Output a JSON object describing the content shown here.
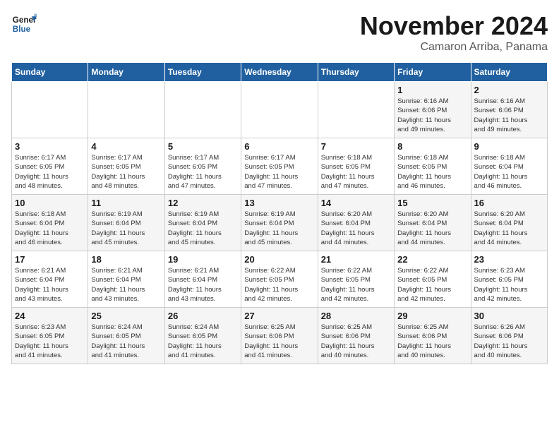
{
  "logo": {
    "text_general": "General",
    "text_blue": "Blue"
  },
  "header": {
    "month": "November 2024",
    "location": "Camaron Arriba, Panama"
  },
  "weekdays": [
    "Sunday",
    "Monday",
    "Tuesday",
    "Wednesday",
    "Thursday",
    "Friday",
    "Saturday"
  ],
  "weeks": [
    [
      {
        "day": "",
        "info": ""
      },
      {
        "day": "",
        "info": ""
      },
      {
        "day": "",
        "info": ""
      },
      {
        "day": "",
        "info": ""
      },
      {
        "day": "",
        "info": ""
      },
      {
        "day": "1",
        "info": "Sunrise: 6:16 AM\nSunset: 6:06 PM\nDaylight: 11 hours\nand 49 minutes."
      },
      {
        "day": "2",
        "info": "Sunrise: 6:16 AM\nSunset: 6:06 PM\nDaylight: 11 hours\nand 49 minutes."
      }
    ],
    [
      {
        "day": "3",
        "info": "Sunrise: 6:17 AM\nSunset: 6:05 PM\nDaylight: 11 hours\nand 48 minutes."
      },
      {
        "day": "4",
        "info": "Sunrise: 6:17 AM\nSunset: 6:05 PM\nDaylight: 11 hours\nand 48 minutes."
      },
      {
        "day": "5",
        "info": "Sunrise: 6:17 AM\nSunset: 6:05 PM\nDaylight: 11 hours\nand 47 minutes."
      },
      {
        "day": "6",
        "info": "Sunrise: 6:17 AM\nSunset: 6:05 PM\nDaylight: 11 hours\nand 47 minutes."
      },
      {
        "day": "7",
        "info": "Sunrise: 6:18 AM\nSunset: 6:05 PM\nDaylight: 11 hours\nand 47 minutes."
      },
      {
        "day": "8",
        "info": "Sunrise: 6:18 AM\nSunset: 6:05 PM\nDaylight: 11 hours\nand 46 minutes."
      },
      {
        "day": "9",
        "info": "Sunrise: 6:18 AM\nSunset: 6:04 PM\nDaylight: 11 hours\nand 46 minutes."
      }
    ],
    [
      {
        "day": "10",
        "info": "Sunrise: 6:18 AM\nSunset: 6:04 PM\nDaylight: 11 hours\nand 46 minutes."
      },
      {
        "day": "11",
        "info": "Sunrise: 6:19 AM\nSunset: 6:04 PM\nDaylight: 11 hours\nand 45 minutes."
      },
      {
        "day": "12",
        "info": "Sunrise: 6:19 AM\nSunset: 6:04 PM\nDaylight: 11 hours\nand 45 minutes."
      },
      {
        "day": "13",
        "info": "Sunrise: 6:19 AM\nSunset: 6:04 PM\nDaylight: 11 hours\nand 45 minutes."
      },
      {
        "day": "14",
        "info": "Sunrise: 6:20 AM\nSunset: 6:04 PM\nDaylight: 11 hours\nand 44 minutes."
      },
      {
        "day": "15",
        "info": "Sunrise: 6:20 AM\nSunset: 6:04 PM\nDaylight: 11 hours\nand 44 minutes."
      },
      {
        "day": "16",
        "info": "Sunrise: 6:20 AM\nSunset: 6:04 PM\nDaylight: 11 hours\nand 44 minutes."
      }
    ],
    [
      {
        "day": "17",
        "info": "Sunrise: 6:21 AM\nSunset: 6:04 PM\nDaylight: 11 hours\nand 43 minutes."
      },
      {
        "day": "18",
        "info": "Sunrise: 6:21 AM\nSunset: 6:04 PM\nDaylight: 11 hours\nand 43 minutes."
      },
      {
        "day": "19",
        "info": "Sunrise: 6:21 AM\nSunset: 6:04 PM\nDaylight: 11 hours\nand 43 minutes."
      },
      {
        "day": "20",
        "info": "Sunrise: 6:22 AM\nSunset: 6:05 PM\nDaylight: 11 hours\nand 42 minutes."
      },
      {
        "day": "21",
        "info": "Sunrise: 6:22 AM\nSunset: 6:05 PM\nDaylight: 11 hours\nand 42 minutes."
      },
      {
        "day": "22",
        "info": "Sunrise: 6:22 AM\nSunset: 6:05 PM\nDaylight: 11 hours\nand 42 minutes."
      },
      {
        "day": "23",
        "info": "Sunrise: 6:23 AM\nSunset: 6:05 PM\nDaylight: 11 hours\nand 42 minutes."
      }
    ],
    [
      {
        "day": "24",
        "info": "Sunrise: 6:23 AM\nSunset: 6:05 PM\nDaylight: 11 hours\nand 41 minutes."
      },
      {
        "day": "25",
        "info": "Sunrise: 6:24 AM\nSunset: 6:05 PM\nDaylight: 11 hours\nand 41 minutes."
      },
      {
        "day": "26",
        "info": "Sunrise: 6:24 AM\nSunset: 6:05 PM\nDaylight: 11 hours\nand 41 minutes."
      },
      {
        "day": "27",
        "info": "Sunrise: 6:25 AM\nSunset: 6:06 PM\nDaylight: 11 hours\nand 41 minutes."
      },
      {
        "day": "28",
        "info": "Sunrise: 6:25 AM\nSunset: 6:06 PM\nDaylight: 11 hours\nand 40 minutes."
      },
      {
        "day": "29",
        "info": "Sunrise: 6:25 AM\nSunset: 6:06 PM\nDaylight: 11 hours\nand 40 minutes."
      },
      {
        "day": "30",
        "info": "Sunrise: 6:26 AM\nSunset: 6:06 PM\nDaylight: 11 hours\nand 40 minutes."
      }
    ]
  ]
}
